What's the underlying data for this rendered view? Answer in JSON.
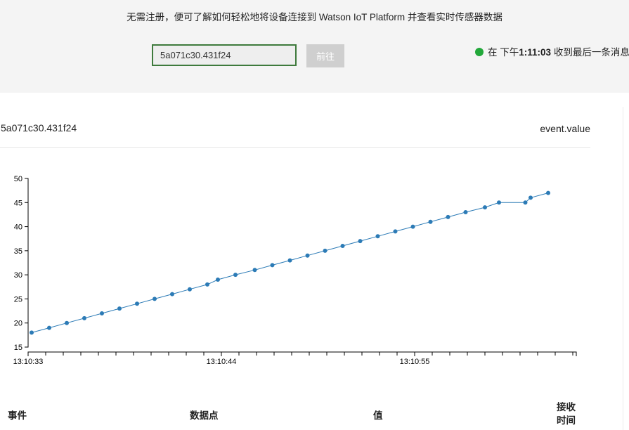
{
  "header": {
    "intro": "无需注册，便可了解如何轻松地将设备连接到 Watson IoT Platform 并查看实时传感器数据",
    "device_id": "5a071c30.431f24",
    "go_label": "前往",
    "status_prefix": "在 下午",
    "status_time": "1:11:03",
    "status_suffix": " 收到最后一条消息"
  },
  "chart_panel": {
    "device_label": "5a071c30.431f24",
    "metric_label": "event.value"
  },
  "chart_data": {
    "type": "line",
    "xlabel": "",
    "ylabel": "",
    "ylim": [
      15,
      50
    ],
    "yticks": [
      "15",
      "20",
      "25",
      "30",
      "35",
      "40",
      "45",
      "50"
    ],
    "xticks": [
      "13:10:33",
      "13:10:44",
      "13:10:55"
    ],
    "grid": false,
    "color": "#2c7bb6",
    "series": [
      {
        "x": [
          "13:10:33.2",
          "13:10:34.2",
          "13:10:35.2",
          "13:10:36.2",
          "13:10:37.2",
          "13:10:38.2",
          "13:10:39.2",
          "13:10:40.2",
          "13:10:41.2",
          "13:10:42.2",
          "13:10:43.2",
          "13:10:43.8",
          "13:10:44.8",
          "13:10:45.9",
          "13:10:46.9",
          "13:10:47.9",
          "13:10:48.9",
          "13:10:49.9",
          "13:10:50.9",
          "13:10:51.9",
          "13:10:52.9",
          "13:10:53.9",
          "13:10:54.9",
          "13:10:55.9",
          "13:10:56.9",
          "13:10:57.9",
          "13:10:59.0",
          "13:10:59.8",
          "13:11:01.3",
          "13:11:01.6",
          "13:11:02.6"
        ],
        "values": [
          18,
          19,
          20,
          21,
          22,
          23,
          24,
          25,
          26,
          27,
          28,
          29,
          30,
          31,
          32,
          33,
          34,
          35,
          36,
          37,
          38,
          39,
          40,
          41,
          42,
          43,
          44,
          45,
          45,
          46,
          47
        ]
      }
    ]
  },
  "table": {
    "columns": [
      "事件",
      "数据点",
      "值",
      "接收\n时间"
    ]
  }
}
